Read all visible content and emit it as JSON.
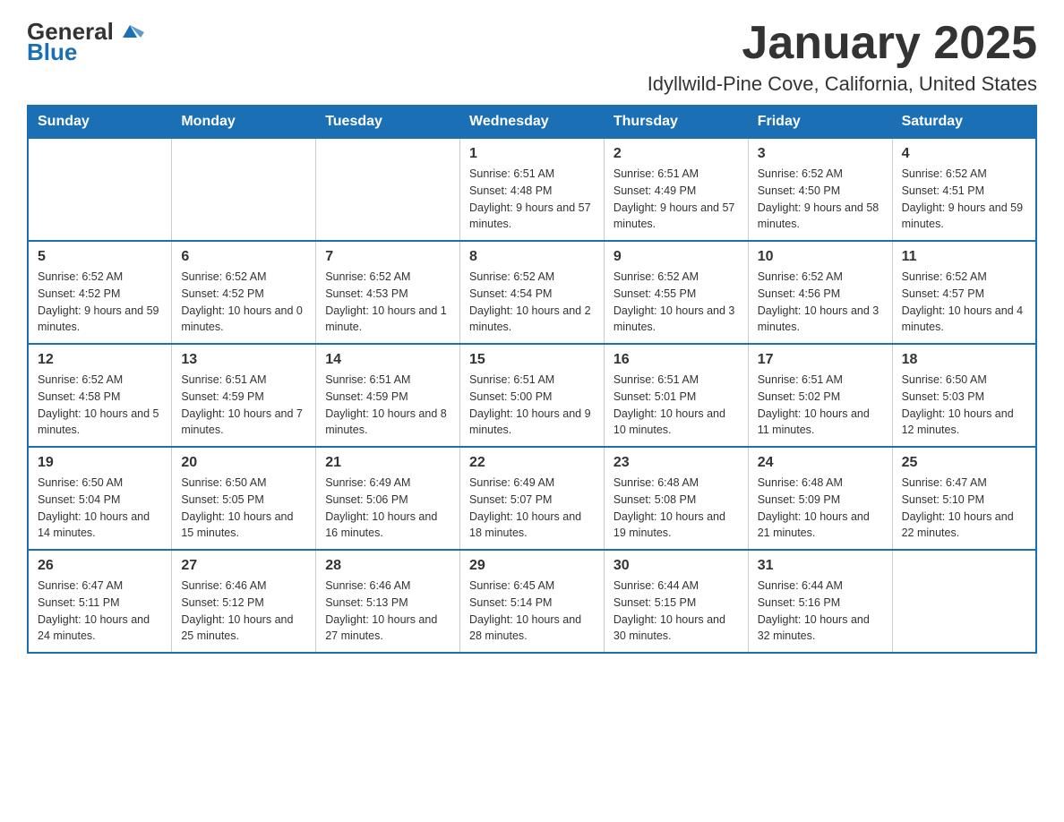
{
  "header": {
    "logo": {
      "general": "General",
      "blue": "Blue"
    },
    "title": "January 2025",
    "location": "Idyllwild-Pine Cove, California, United States"
  },
  "weekdays": [
    "Sunday",
    "Monday",
    "Tuesday",
    "Wednesday",
    "Thursday",
    "Friday",
    "Saturday"
  ],
  "weeks": [
    [
      {
        "day": "",
        "info": ""
      },
      {
        "day": "",
        "info": ""
      },
      {
        "day": "",
        "info": ""
      },
      {
        "day": "1",
        "info": "Sunrise: 6:51 AM\nSunset: 4:48 PM\nDaylight: 9 hours and 57 minutes."
      },
      {
        "day": "2",
        "info": "Sunrise: 6:51 AM\nSunset: 4:49 PM\nDaylight: 9 hours and 57 minutes."
      },
      {
        "day": "3",
        "info": "Sunrise: 6:52 AM\nSunset: 4:50 PM\nDaylight: 9 hours and 58 minutes."
      },
      {
        "day": "4",
        "info": "Sunrise: 6:52 AM\nSunset: 4:51 PM\nDaylight: 9 hours and 59 minutes."
      }
    ],
    [
      {
        "day": "5",
        "info": "Sunrise: 6:52 AM\nSunset: 4:52 PM\nDaylight: 9 hours and 59 minutes."
      },
      {
        "day": "6",
        "info": "Sunrise: 6:52 AM\nSunset: 4:52 PM\nDaylight: 10 hours and 0 minutes."
      },
      {
        "day": "7",
        "info": "Sunrise: 6:52 AM\nSunset: 4:53 PM\nDaylight: 10 hours and 1 minute."
      },
      {
        "day": "8",
        "info": "Sunrise: 6:52 AM\nSunset: 4:54 PM\nDaylight: 10 hours and 2 minutes."
      },
      {
        "day": "9",
        "info": "Sunrise: 6:52 AM\nSunset: 4:55 PM\nDaylight: 10 hours and 3 minutes."
      },
      {
        "day": "10",
        "info": "Sunrise: 6:52 AM\nSunset: 4:56 PM\nDaylight: 10 hours and 3 minutes."
      },
      {
        "day": "11",
        "info": "Sunrise: 6:52 AM\nSunset: 4:57 PM\nDaylight: 10 hours and 4 minutes."
      }
    ],
    [
      {
        "day": "12",
        "info": "Sunrise: 6:52 AM\nSunset: 4:58 PM\nDaylight: 10 hours and 5 minutes."
      },
      {
        "day": "13",
        "info": "Sunrise: 6:51 AM\nSunset: 4:59 PM\nDaylight: 10 hours and 7 minutes."
      },
      {
        "day": "14",
        "info": "Sunrise: 6:51 AM\nSunset: 4:59 PM\nDaylight: 10 hours and 8 minutes."
      },
      {
        "day": "15",
        "info": "Sunrise: 6:51 AM\nSunset: 5:00 PM\nDaylight: 10 hours and 9 minutes."
      },
      {
        "day": "16",
        "info": "Sunrise: 6:51 AM\nSunset: 5:01 PM\nDaylight: 10 hours and 10 minutes."
      },
      {
        "day": "17",
        "info": "Sunrise: 6:51 AM\nSunset: 5:02 PM\nDaylight: 10 hours and 11 minutes."
      },
      {
        "day": "18",
        "info": "Sunrise: 6:50 AM\nSunset: 5:03 PM\nDaylight: 10 hours and 12 minutes."
      }
    ],
    [
      {
        "day": "19",
        "info": "Sunrise: 6:50 AM\nSunset: 5:04 PM\nDaylight: 10 hours and 14 minutes."
      },
      {
        "day": "20",
        "info": "Sunrise: 6:50 AM\nSunset: 5:05 PM\nDaylight: 10 hours and 15 minutes."
      },
      {
        "day": "21",
        "info": "Sunrise: 6:49 AM\nSunset: 5:06 PM\nDaylight: 10 hours and 16 minutes."
      },
      {
        "day": "22",
        "info": "Sunrise: 6:49 AM\nSunset: 5:07 PM\nDaylight: 10 hours and 18 minutes."
      },
      {
        "day": "23",
        "info": "Sunrise: 6:48 AM\nSunset: 5:08 PM\nDaylight: 10 hours and 19 minutes."
      },
      {
        "day": "24",
        "info": "Sunrise: 6:48 AM\nSunset: 5:09 PM\nDaylight: 10 hours and 21 minutes."
      },
      {
        "day": "25",
        "info": "Sunrise: 6:47 AM\nSunset: 5:10 PM\nDaylight: 10 hours and 22 minutes."
      }
    ],
    [
      {
        "day": "26",
        "info": "Sunrise: 6:47 AM\nSunset: 5:11 PM\nDaylight: 10 hours and 24 minutes."
      },
      {
        "day": "27",
        "info": "Sunrise: 6:46 AM\nSunset: 5:12 PM\nDaylight: 10 hours and 25 minutes."
      },
      {
        "day": "28",
        "info": "Sunrise: 6:46 AM\nSunset: 5:13 PM\nDaylight: 10 hours and 27 minutes."
      },
      {
        "day": "29",
        "info": "Sunrise: 6:45 AM\nSunset: 5:14 PM\nDaylight: 10 hours and 28 minutes."
      },
      {
        "day": "30",
        "info": "Sunrise: 6:44 AM\nSunset: 5:15 PM\nDaylight: 10 hours and 30 minutes."
      },
      {
        "day": "31",
        "info": "Sunrise: 6:44 AM\nSunset: 5:16 PM\nDaylight: 10 hours and 32 minutes."
      },
      {
        "day": "",
        "info": ""
      }
    ]
  ]
}
